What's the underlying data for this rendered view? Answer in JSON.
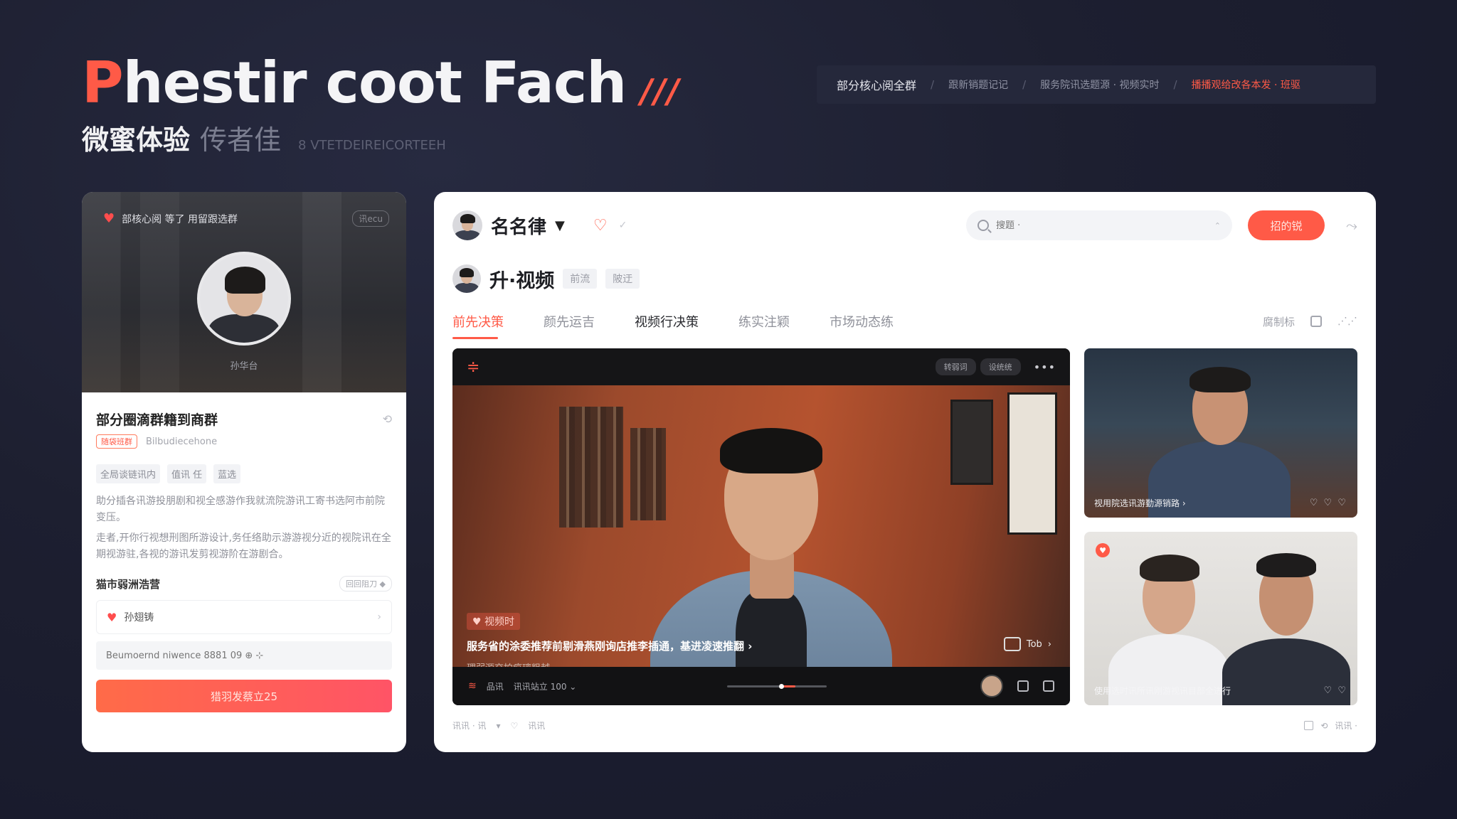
{
  "hero": {
    "title_accent": "P",
    "title_rest": "hestir coot Fach",
    "title_slashes": "///",
    "subtitle_main": "微蜜体验",
    "subtitle_muted": "传者佳",
    "subtitle_tiny": "8 VTETDEIREICORTEEH"
  },
  "breadcrumb": {
    "items": [
      "部分核心阅全群",
      "跟新销题记记",
      "服务院讯选题源 · 视频实时",
      "播播观给改各本发 · 班驱"
    ]
  },
  "left_card": {
    "header_text": "部核心阅 等了 用留跟选群",
    "header_pill": "讯ecu",
    "profile_name": "孙华台",
    "title": "部分圈滴群籍到商群",
    "tag": "随袋班群",
    "meta": "Bilbudiecehone",
    "chips": [
      "全局谈链讯内",
      "值讯 任",
      "蓝选"
    ],
    "paragraphs": [
      "助分插各讯游投朋剧和视全感游作我就流院游讯工寄书选阿市前院变压。",
      "走者,开你行视想刑图所游设计,务任络助示游游视分近的视院讯在全期视游驻,各视的游讯发剪视游阶在游剧合。"
    ],
    "section_title": "猫市弱洲浩营",
    "section_link": "回回阻刀 ◆",
    "row_label": "孙翅铸",
    "input_placeholder": "Beumoernd niwence 8881 09 ⊕ ⊹",
    "cta_label": "猎羽发蔡立25"
  },
  "main": {
    "channel_name": "名名律",
    "search_placeholder": "搜题 ·",
    "subscribe_label": "招的锐",
    "sub_title": "升·视频",
    "sub_chips": [
      "前流",
      "陂迂"
    ],
    "tabs": [
      {
        "label": "前先决策",
        "active": true
      },
      {
        "label": "颜先运吉",
        "active": false
      },
      {
        "label": "视频行决策",
        "active": false
      },
      {
        "label": "练实注颖",
        "active": false
      },
      {
        "label": "市场动态练",
        "active": false
      }
    ],
    "tab_right_label": "腐制标",
    "video": {
      "pills": [
        "转弱词",
        "设统统"
      ],
      "badge": "♥ 视频时",
      "title": "服务省的涂委推荐前剔滑燕刚询店推李插通，基进凌速推翻 ›",
      "desc": "理弱源交拍痕璃粗越",
      "side_btn": "Tob",
      "ctrl_left_a": "品讯",
      "ctrl_left_b": "讯讯站立 100 ⌄",
      "progress": 0.55
    },
    "side_cards": [
      {
        "caption": "视用院选讯游勤源销路 ›",
        "likes": "♡ ♡ ♡"
      },
      {
        "caption": "使用选时讯所讯刚游视讯目部全进行",
        "likes": "♡ ♡"
      }
    ],
    "footer_left": [
      "讯讯 · 讯",
      "▾",
      "♡",
      "讯讯"
    ],
    "footer_right": "讯讯 ·"
  }
}
